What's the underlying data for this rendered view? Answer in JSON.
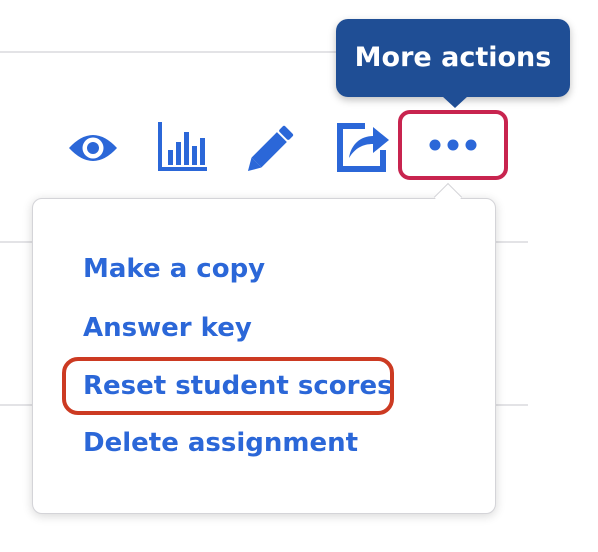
{
  "tooltip": {
    "text": "More actions",
    "color": "#1f4e95"
  },
  "toolbar": {
    "icons": [
      "eye-icon",
      "bar-chart-icon",
      "pencil-icon",
      "share-icon",
      "more-dots-icon"
    ],
    "icon_color": "#2b67d8",
    "more_highlight_color": "#c8244f"
  },
  "menu": {
    "items": [
      {
        "label": "Make a copy"
      },
      {
        "label": "Answer key"
      },
      {
        "label": "Reset student scores",
        "highlighted": true
      },
      {
        "label": "Delete assignment"
      }
    ],
    "text_color": "#2b67d8",
    "highlight_color": "#cc3a22"
  }
}
